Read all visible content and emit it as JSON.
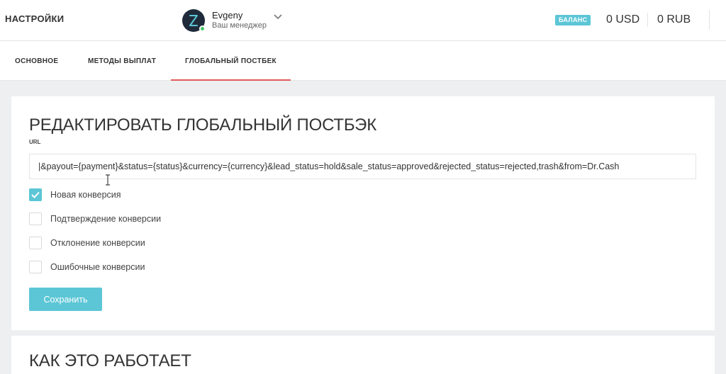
{
  "header": {
    "page_title": "НАСТРОЙКИ",
    "manager": {
      "name": "Evgeny",
      "role": "Ваш менеджер"
    },
    "balance_label": "БАЛАНС",
    "balance_usd": "0 USD",
    "balance_rub": "0 RUB"
  },
  "tabs": [
    {
      "label": "ОСНОВНОЕ"
    },
    {
      "label": "МЕТОДЫ ВЫПЛАТ"
    },
    {
      "label": "ГЛОБАЛЬНЫЙ ПОСТБЕК",
      "active": true
    }
  ],
  "editor": {
    "title": "РЕДАКТИРОВАТЬ ГЛОБАЛЬНЫЙ ПОСТБЭК",
    "url_label": "URL",
    "url_value": "|&payout={payment}&status={status}&currency={currency}&lead_status=hold&sale_status=approved&rejected_status=rejected,trash&from=Dr.Cash",
    "checkboxes": [
      {
        "label": "Новая конверсия",
        "checked": true
      },
      {
        "label": "Подтверждение конверсии",
        "checked": false
      },
      {
        "label": "Отклонение конверсии",
        "checked": false
      },
      {
        "label": "Ошибочные конверсии",
        "checked": false
      }
    ],
    "save_label": "Сохранить"
  },
  "how_it_works": {
    "title": "КАК ЭТО РАБОТАЕТ"
  },
  "colors": {
    "accent": "#5cc6d6",
    "active_tab_underline": "#e45a5a",
    "status_online": "#42c86a",
    "avatar_bg": "#1f2b3a"
  },
  "icons": {
    "avatar": "hourglass-logo-icon",
    "dropdown": "chevron-down-icon",
    "check": "check-icon"
  }
}
